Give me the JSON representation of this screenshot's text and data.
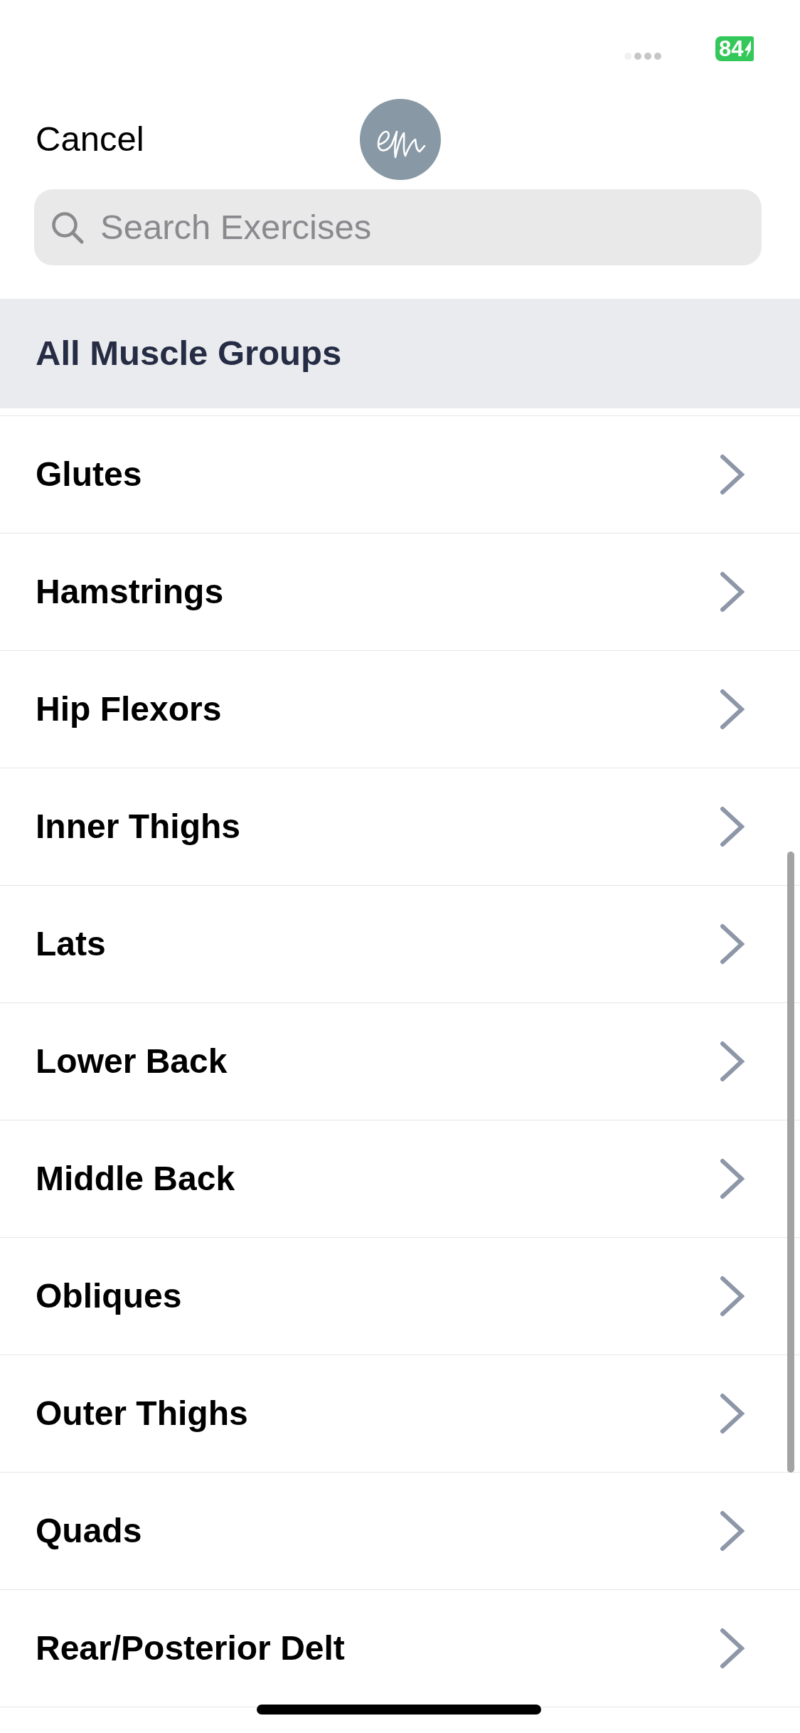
{
  "status_bar": {
    "battery": "84",
    "charging": true
  },
  "header": {
    "cancel": "Cancel"
  },
  "search": {
    "placeholder": "Search Exercises"
  },
  "section": {
    "label": "All Muscle Groups"
  },
  "muscle_groups": [
    {
      "label": "Glutes"
    },
    {
      "label": "Hamstrings"
    },
    {
      "label": "Hip Flexors"
    },
    {
      "label": "Inner Thighs"
    },
    {
      "label": "Lats"
    },
    {
      "label": "Lower Back"
    },
    {
      "label": "Middle Back"
    },
    {
      "label": "Obliques"
    },
    {
      "label": "Outer Thighs"
    },
    {
      "label": "Quads"
    },
    {
      "label": "Rear/Posterior Delt"
    }
  ]
}
